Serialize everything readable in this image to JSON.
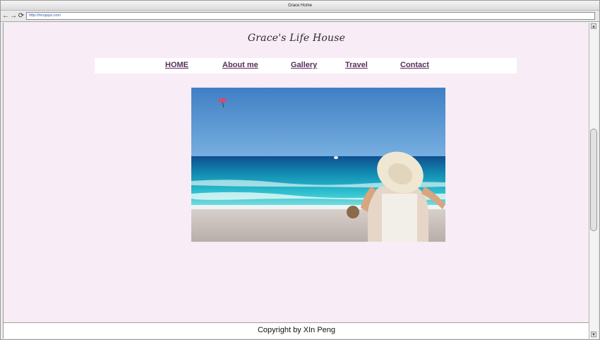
{
  "window": {
    "title": "Grace Home"
  },
  "toolbar": {
    "back_icon": "back-arrow-icon",
    "forward_icon": "forward-arrow-icon",
    "reload_icon": "reload-icon",
    "url": "http://mcqups.com"
  },
  "site": {
    "title": "Grace's Life House",
    "nav": [
      {
        "label": "HOME"
      },
      {
        "label": "About me"
      },
      {
        "label": "Gallery"
      },
      {
        "label": "Travel"
      },
      {
        "label": "Contact"
      }
    ]
  },
  "hero": {
    "image": "beach-photo-woman-in-sun-hat",
    "colors": {
      "sky": "#4f8fd0",
      "sea": "#1ea7c4",
      "sand": "#c8bdb7"
    }
  },
  "footer": {
    "text": "Copyright by XIn Peng"
  },
  "colors": {
    "page_bg": "#f8ecf6",
    "nav_link": "#5b2d5b"
  }
}
